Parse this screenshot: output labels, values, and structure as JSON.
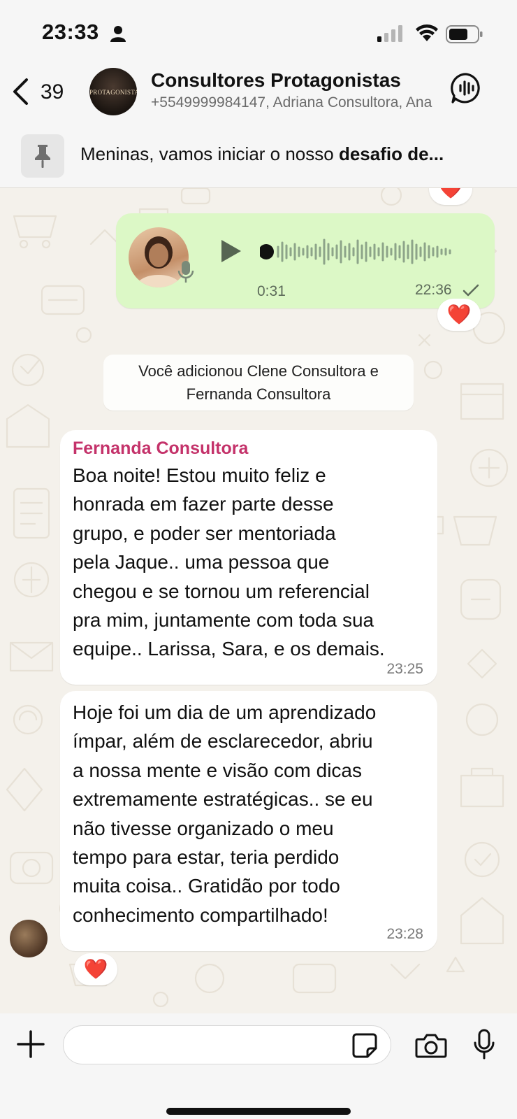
{
  "status_bar": {
    "time": "23:33"
  },
  "header": {
    "back_count": "39",
    "group_name": "Consultores Protagonistas",
    "group_members": "+5549999984147, Adriana Consultora, Ana",
    "avatar_text": "PROTAGONISTAS"
  },
  "pinned": {
    "text_normal": "Meninas, vamos iniciar o nosso ",
    "text_bold": "desafio de..."
  },
  "voice_message": {
    "duration": "0:31",
    "time": "22:36",
    "reaction": "❤️"
  },
  "top_reaction": "❤️",
  "system_message": {
    "line1": "Você adicionou Clene Consultora e",
    "line2": "Fernanda Consultora"
  },
  "messages": [
    {
      "sender": "Fernanda Consultora",
      "text": "Boa noite! Estou muito feliz e\nhonrada em fazer parte desse\ngrupo, e poder ser mentoriada\npela Jaque.. uma pessoa que\nchegou e se tornou um referencial\npra mim, juntamente com toda sua\nequipe.. Larissa, Sara, e os demais.",
      "time": "23:25"
    },
    {
      "sender": "",
      "text": "Hoje foi um dia de um aprendizado\nímpar, além de esclarecedor, abriu\na nossa mente e visão com dicas\nextremamente estratégicas.. se eu\nnão tivesse organizado o meu\ntempo para estar, teria perdido\nmuita coisa.. Gratidão por todo\nconhecimento compartilhado!",
      "time": "23:28",
      "reaction": "❤️"
    }
  ],
  "input": {
    "value": "",
    "placeholder": ""
  },
  "colors": {
    "outgoing_bubble": "#dcf8c6",
    "incoming_bubble": "#ffffff",
    "sender_name": "#c4326a",
    "chat_background": "#f4f1eb"
  },
  "icons": {
    "status": [
      "person-icon",
      "signal-icon",
      "wifi-icon",
      "battery-icon"
    ],
    "header": [
      "back-chevron-icon",
      "call-waveform-icon"
    ],
    "pinned": "pin-icon",
    "input": [
      "plus-icon",
      "sticker-icon",
      "camera-icon",
      "microphone-icon"
    ]
  }
}
